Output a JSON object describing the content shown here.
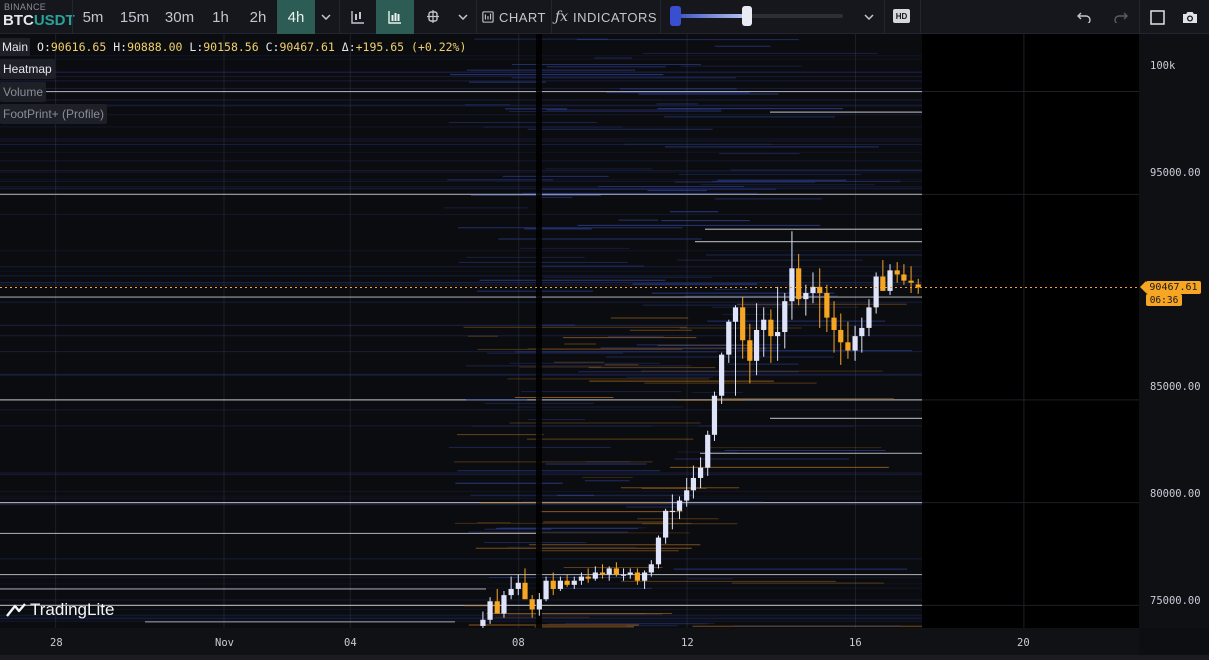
{
  "header": {
    "exchange": "BINANCE",
    "pair_base": "BTC",
    "pair_quote": "USDT",
    "timeframes": [
      {
        "label": "5m",
        "active": false
      },
      {
        "label": "15m",
        "active": false
      },
      {
        "label": "30m",
        "active": false
      },
      {
        "label": "1h",
        "active": false
      },
      {
        "label": "2h",
        "active": false
      },
      {
        "label": "4h",
        "active": true
      }
    ],
    "chart_label": "CHART",
    "indicators_label": "INDICATORS",
    "hd_label": "HD",
    "icons": [
      "chevron-down-icon",
      "candles-icon",
      "candles-filled-icon",
      "crosshair-icon",
      "chevron-down-icon",
      "chart-type-icon",
      "function-icon",
      "chevron-down-icon",
      "undo-icon",
      "redo-icon",
      "fullscreen-icon",
      "camera-icon"
    ],
    "heatmap_slider_level": 0.43
  },
  "ohlc": {
    "title": "Main",
    "o_key": "O:",
    "o": "90616.65",
    "h_key": "H:",
    "h": "90888.00",
    "l_key": "L:",
    "l": "90158.56",
    "c_key": "C:",
    "c": "90467.61",
    "delta_key": "Δ:",
    "delta": "+195.65 (+0.22%)"
  },
  "panes": [
    "Heatmap",
    "Volume",
    "FootPrint+ (Profile)"
  ],
  "logo": "TradingLite",
  "price_axis": {
    "labels": [
      "100k",
      "95000.00",
      "85000.00",
      "80000.00",
      "75000.00"
    ],
    "current_price": "90467.61",
    "countdown": "06:36"
  },
  "time_axis": {
    "labels": [
      "28",
      "Nov",
      "04",
      "08",
      "12",
      "16",
      "20"
    ]
  },
  "colors": {
    "up": "#e0e4fa",
    "down": "#f6a623",
    "accent": "#2d5c54",
    "price_line": "#f6a623"
  },
  "chart_data": {
    "type": "candlestick",
    "symbol": "BTCUSDT",
    "interval": "4h",
    "ylim": [
      73900,
      102800
    ],
    "price_ticks": [
      100000,
      95000,
      85000,
      80000,
      75000
    ],
    "time_ticks": [
      {
        "label": "28",
        "day": -4
      },
      {
        "label": "Nov",
        "day": 0
      },
      {
        "label": "04",
        "day": 3
      },
      {
        "label": "08",
        "day": 7
      },
      {
        "label": "12",
        "day": 11
      },
      {
        "label": "16",
        "day": 15
      },
      {
        "label": "20",
        "day": 19
      }
    ],
    "current_price": 90467.61,
    "candles": [
      [
        6.15,
        74000,
        74700,
        73900,
        74300
      ],
      [
        6.32,
        74300,
        75400,
        74100,
        75200
      ],
      [
        6.49,
        75200,
        75800,
        74800,
        74600
      ],
      [
        6.65,
        74600,
        75700,
        74400,
        75500
      ],
      [
        6.82,
        75500,
        76400,
        75300,
        75800
      ],
      [
        6.99,
        75800,
        76500,
        75500,
        76100
      ],
      [
        7.15,
        76100,
        76800,
        75600,
        75300
      ],
      [
        7.32,
        75300,
        75500,
        74400,
        74800
      ],
      [
        7.49,
        74800,
        75600,
        74500,
        75300
      ],
      [
        7.65,
        75300,
        76400,
        75200,
        76200
      ],
      [
        7.82,
        76200,
        76600,
        75500,
        75800
      ],
      [
        7.99,
        75800,
        76400,
        75700,
        76200
      ],
      [
        8.15,
        76200,
        76500,
        75900,
        76000
      ],
      [
        8.32,
        76000,
        76400,
        75800,
        76200
      ],
      [
        8.49,
        76200,
        76600,
        76000,
        76400
      ],
      [
        8.65,
        76400,
        76800,
        76100,
        76300
      ],
      [
        8.82,
        76300,
        76900,
        76200,
        76600
      ],
      [
        8.99,
        76600,
        77000,
        76300,
        76500
      ],
      [
        9.15,
        76500,
        76900,
        76200,
        76800
      ],
      [
        9.32,
        76800,
        77100,
        76400,
        76500
      ],
      [
        9.49,
        76500,
        76800,
        76200,
        76500
      ],
      [
        9.65,
        76500,
        76800,
        76300,
        76600
      ],
      [
        9.82,
        76600,
        76800,
        76000,
        76200
      ],
      [
        9.99,
        76200,
        76700,
        75800,
        76600
      ],
      [
        10.15,
        76600,
        77200,
        76400,
        77000
      ],
      [
        10.32,
        77000,
        78400,
        76800,
        78300
      ],
      [
        10.49,
        78300,
        79700,
        78000,
        79600
      ],
      [
        10.65,
        79600,
        80400,
        78700,
        79600
      ],
      [
        10.82,
        79600,
        80300,
        79200,
        80100
      ],
      [
        10.99,
        80100,
        81200,
        79800,
        80600
      ],
      [
        11.15,
        80600,
        81800,
        80200,
        81200
      ],
      [
        11.32,
        81200,
        82200,
        80700,
        81700
      ],
      [
        11.49,
        81700,
        83500,
        81300,
        83300
      ],
      [
        11.65,
        83300,
        85400,
        83000,
        85200
      ],
      [
        11.82,
        85200,
        87300,
        84800,
        87200
      ],
      [
        11.99,
        87200,
        88900,
        86800,
        88800
      ],
      [
        12.15,
        88800,
        89600,
        85200,
        89500
      ],
      [
        12.32,
        89500,
        90000,
        87000,
        87900
      ],
      [
        12.49,
        87900,
        88700,
        85800,
        86900
      ],
      [
        12.65,
        86900,
        89700,
        86200,
        88400
      ],
      [
        12.82,
        88400,
        89500,
        87100,
        88900
      ],
      [
        12.99,
        88900,
        89400,
        86800,
        88100
      ],
      [
        13.15,
        88100,
        90500,
        86900,
        88300
      ],
      [
        13.32,
        88300,
        90200,
        87500,
        89800
      ],
      [
        13.49,
        89800,
        93200,
        88900,
        91400
      ],
      [
        13.65,
        91400,
        92100,
        89600,
        89900
      ],
      [
        13.82,
        89900,
        90600,
        89100,
        90200
      ],
      [
        13.99,
        90200,
        91200,
        89700,
        90500
      ],
      [
        14.15,
        90500,
        91400,
        88500,
        90200
      ],
      [
        14.32,
        90200,
        90600,
        88300,
        89000
      ],
      [
        14.49,
        89000,
        89800,
        87300,
        88400
      ],
      [
        14.65,
        88400,
        89200,
        86700,
        87800
      ],
      [
        14.82,
        87800,
        88800,
        87000,
        87400
      ],
      [
        14.99,
        87400,
        88600,
        86900,
        88100
      ],
      [
        15.15,
        88100,
        89000,
        87300,
        88500
      ],
      [
        15.32,
        88500,
        89900,
        88100,
        89500
      ],
      [
        15.49,
        89500,
        91200,
        89200,
        91000
      ],
      [
        15.65,
        91000,
        91800,
        90400,
        90300
      ],
      [
        15.82,
        90300,
        91600,
        90100,
        91300
      ],
      [
        15.99,
        91300,
        91700,
        90700,
        91100
      ],
      [
        16.15,
        91100,
        91600,
        90600,
        90800
      ],
      [
        16.32,
        90800,
        91500,
        90200,
        90700
      ],
      [
        16.49,
        90616.65,
        90888,
        90158.56,
        90467.61
      ]
    ]
  }
}
